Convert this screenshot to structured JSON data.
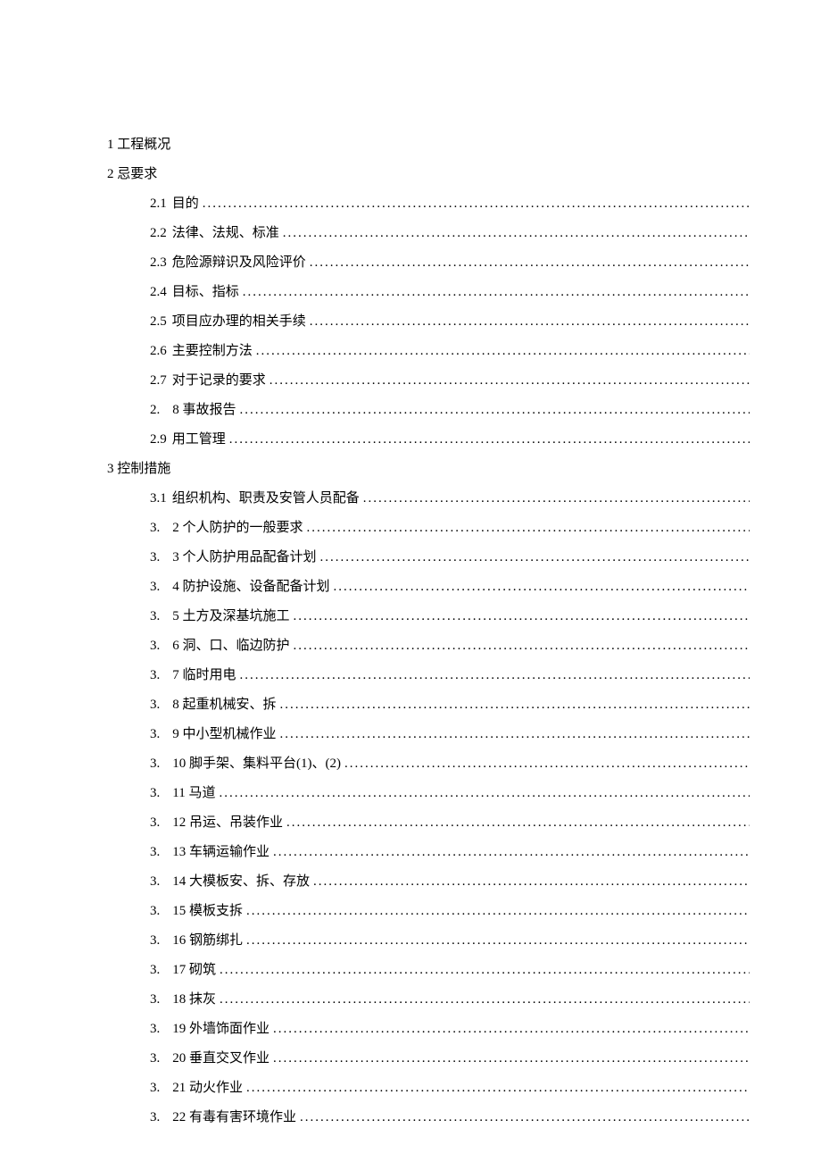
{
  "sections": [
    {
      "heading": "1 工程概况",
      "items": []
    },
    {
      "heading": "2 忌要求",
      "items": [
        {
          "num": "2.1",
          "title": "目的",
          "split": false
        },
        {
          "num": "2.2",
          "title": "法律、法规、标准",
          "split": false
        },
        {
          "num": "2.3",
          "title": "危险源辩识及风险评价",
          "split": false
        },
        {
          "num": "2.4",
          "title": "目标、指标",
          "split": false
        },
        {
          "num": "2.5",
          "title": "项目应办理的相关手续",
          "split": false
        },
        {
          "num": "2.6",
          "title": "主要控制方法",
          "split": false
        },
        {
          "num": "2.7",
          "title": "对于记录的要求",
          "split": false
        },
        {
          "num": "2.",
          "title": "8 事故报告",
          "split": true
        },
        {
          "num": "2.9",
          "title": "用工管理",
          "split": false
        }
      ]
    },
    {
      "heading": "3 控制措施",
      "items": [
        {
          "num": "3.1",
          "title": "组织机构、职责及安管人员配备",
          "split": false
        },
        {
          "num": "3.",
          "title": "2 个人防护的一般要求",
          "split": true
        },
        {
          "num": "3.",
          "title": "3 个人防护用品配备计划",
          "split": true
        },
        {
          "num": "3.",
          "title": "4 防护设施、设备配备计划",
          "split": true
        },
        {
          "num": "3.",
          "title": "5 土方及深基坑施工",
          "split": true
        },
        {
          "num": "3.",
          "title": "6 洞、口、临边防护",
          "split": true
        },
        {
          "num": "3.",
          "title": "7 临时用电",
          "split": true
        },
        {
          "num": "3.",
          "title": "8 起重机械安、拆",
          "split": true
        },
        {
          "num": "3.",
          "title": "9 中小型机械作业",
          "split": true
        },
        {
          "num": "3.",
          "title": "10 脚手架、集料平台(1)、(2)",
          "split": true
        },
        {
          "num": "3.",
          "title": "11 马道",
          "split": true
        },
        {
          "num": "3.",
          "title": "12 吊运、吊装作业",
          "split": true
        },
        {
          "num": "3.",
          "title": "13 车辆运输作业",
          "split": true
        },
        {
          "num": "3.",
          "title": "14 大模板安、拆、存放",
          "split": true
        },
        {
          "num": "3.",
          "title": "15 模板支拆",
          "split": true
        },
        {
          "num": "3.",
          "title": "16 钢筋绑扎",
          "split": true
        },
        {
          "num": "3.",
          "title": "17 砌筑",
          "split": true
        },
        {
          "num": "3.",
          "title": "18 抹灰",
          "split": true
        },
        {
          "num": "3.",
          "title": "19 外墙饰面作业",
          "split": true
        },
        {
          "num": "3.",
          "title": "20 垂直交叉作业",
          "split": true
        },
        {
          "num": "3.",
          "title": "21 动火作业",
          "split": true
        },
        {
          "num": "3.",
          "title": "22 有毒有害环境作业",
          "split": true
        }
      ]
    }
  ]
}
